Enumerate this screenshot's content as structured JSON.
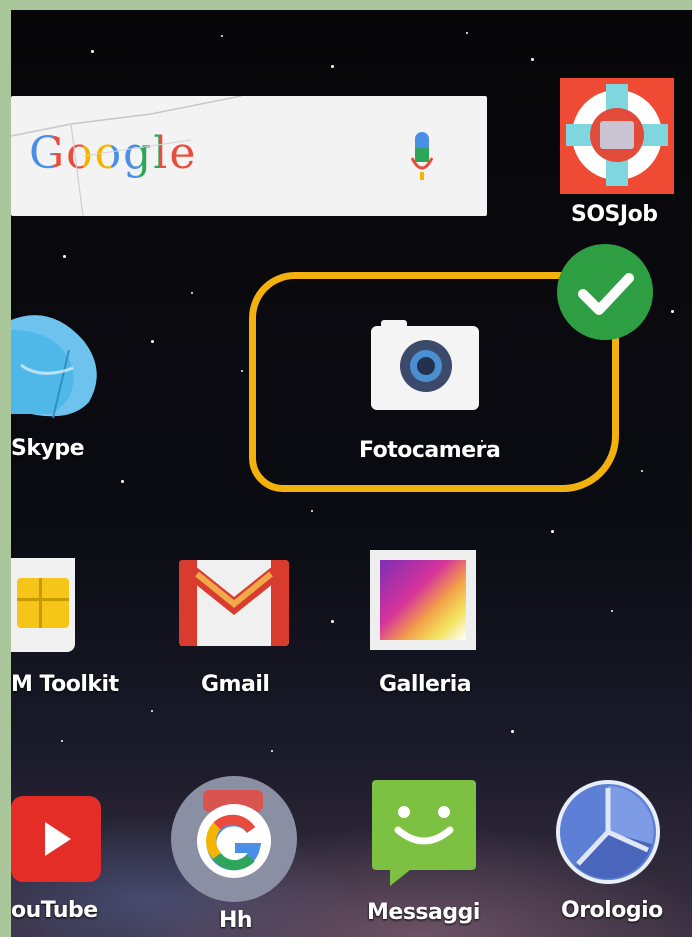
{
  "widget": {
    "google_logo": "Google"
  },
  "apps": {
    "sosjob": {
      "label": "SOSJob"
    },
    "skype": {
      "label": "Skype"
    },
    "fotocamera": {
      "label": "Fotocamera"
    },
    "simtoolkit": {
      "label": "M Toolkit"
    },
    "gmail": {
      "label": "Gmail"
    },
    "galleria": {
      "label": "Galleria"
    },
    "youtube": {
      "label": "ouTube"
    },
    "hh": {
      "label": "Hh"
    },
    "messaggi": {
      "label": "Messaggi"
    },
    "orologio": {
      "label": "Orologio"
    }
  },
  "annotation": {
    "highlight_color": "#f2b10c",
    "check_color": "#2e9e43"
  },
  "colors": {
    "frame": "#a9c79a",
    "sos_red": "#ef4a34",
    "gmail_red": "#d93b2f",
    "youtube_red": "#e52d27",
    "messaggi_green": "#7cc142",
    "skype_blue": "#4fb8e8"
  }
}
